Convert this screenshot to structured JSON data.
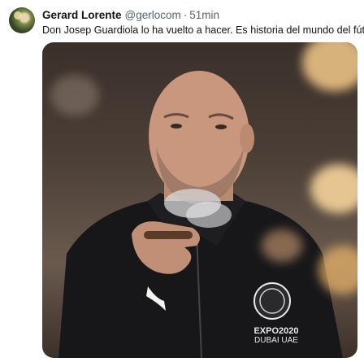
{
  "tweet": {
    "author_name": "Gerard Lorente",
    "author_handle": "@gerlocom",
    "separator": "·",
    "time_ago": "51min",
    "text": "Don Josep Guardiola lo ha vuelto a hacer. Es historia del mundo del fútbol."
  },
  "media": {
    "jacket_text_line1": "EXPO2020",
    "jacket_text_line2": "DUBAI UAE"
  }
}
